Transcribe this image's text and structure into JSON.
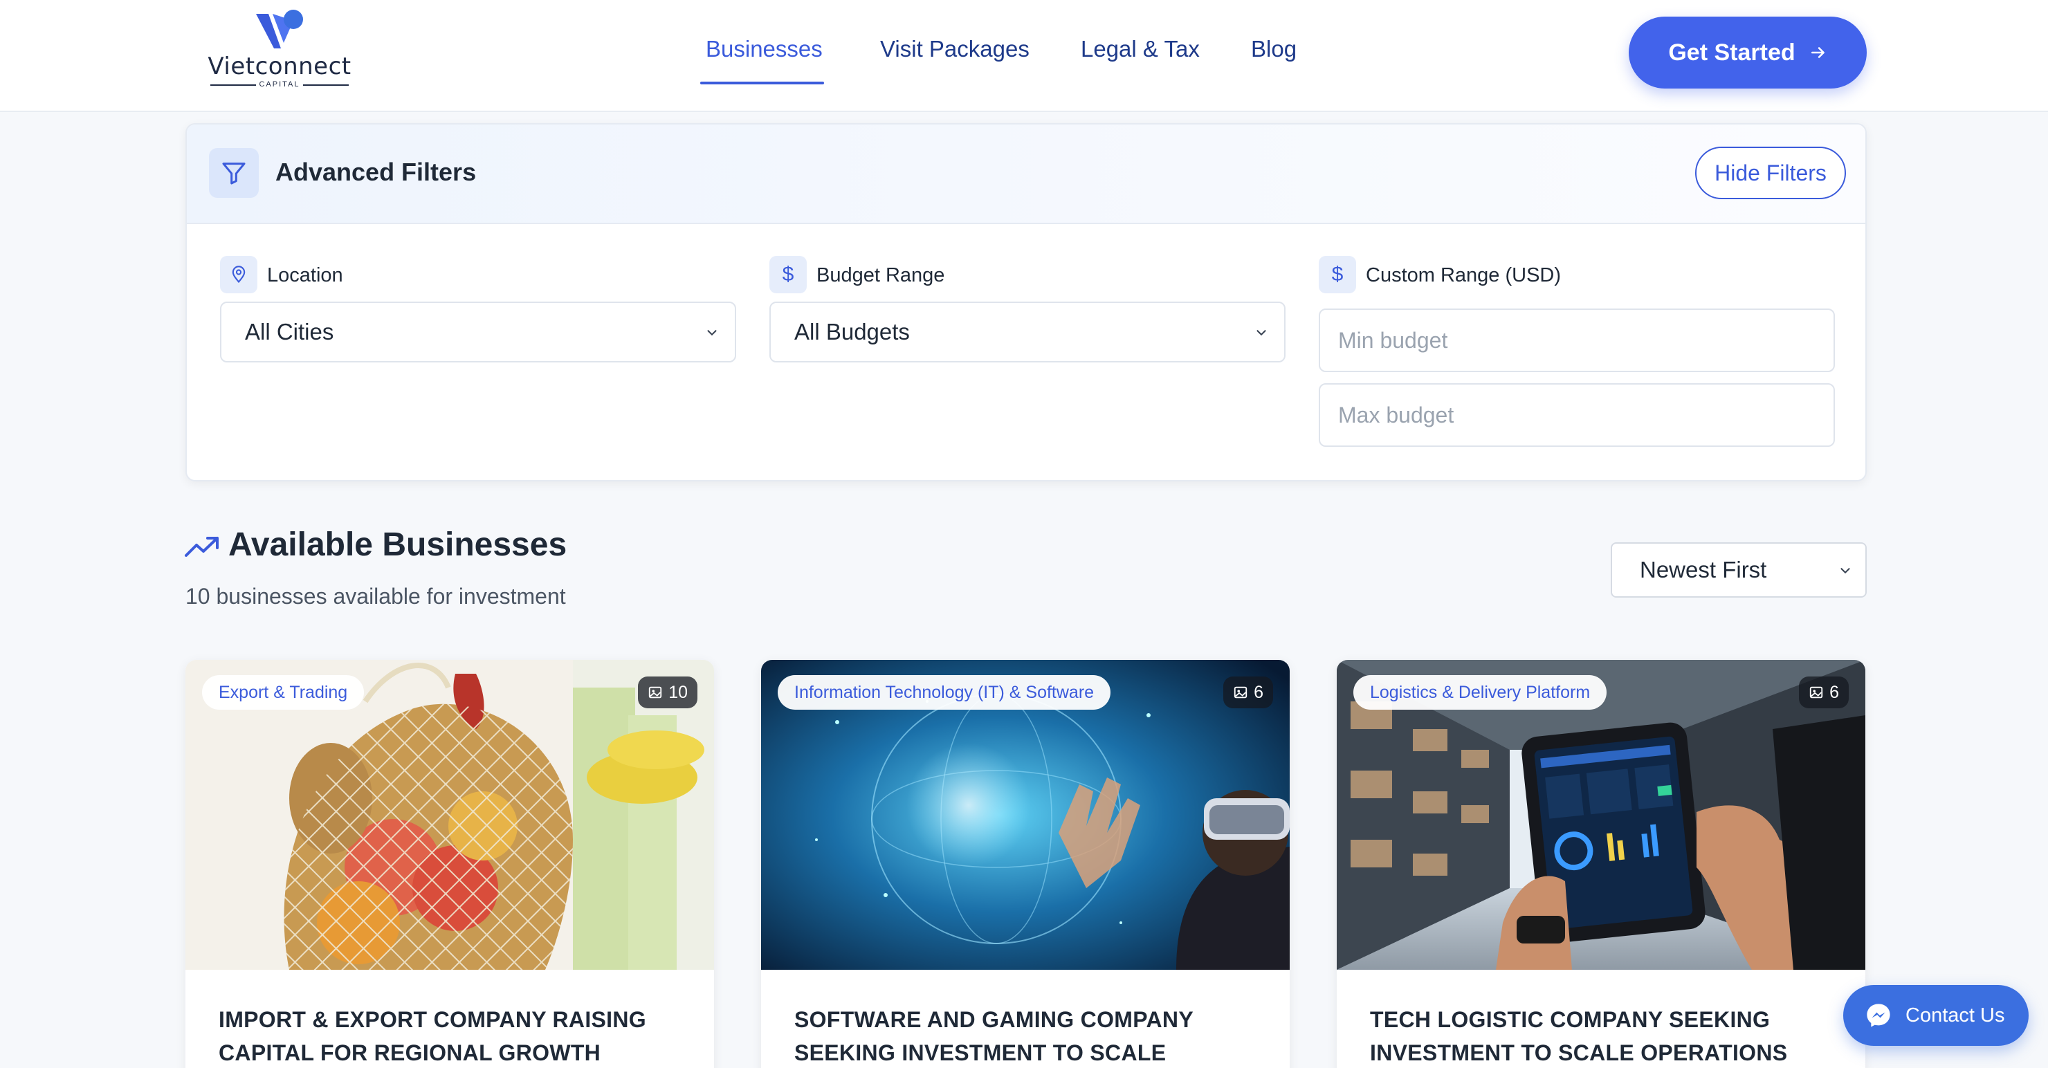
{
  "brand": {
    "name": "Vietconnect",
    "tagline": "CAPITAL",
    "color": "#3b5bdb"
  },
  "nav": {
    "items": [
      {
        "label": "Businesses",
        "active": true
      },
      {
        "label": "Visit Packages",
        "active": false
      },
      {
        "label": "Legal & Tax",
        "active": false
      },
      {
        "label": "Blog",
        "active": false
      }
    ],
    "cta_label": "Get Started"
  },
  "filters": {
    "title": "Advanced Filters",
    "hide_label": "Hide Filters",
    "location": {
      "label": "Location",
      "value": "All Cities",
      "icon": "map-pin-icon"
    },
    "budget": {
      "label": "Budget Range",
      "value": "All Budgets",
      "icon": "dollar-icon"
    },
    "custom": {
      "label": "Custom Range (USD)",
      "min_placeholder": "Min budget",
      "max_placeholder": "Max budget",
      "icon": "dollar-icon"
    }
  },
  "listing": {
    "title": "Available Businesses",
    "subtitle": "10 businesses available for investment",
    "sort_value": "Newest First"
  },
  "cards": [
    {
      "category": "Export & Trading",
      "image_count": "10",
      "title": "Import & Export Company Raising Capital for Regional Growth"
    },
    {
      "category": "Information Technology (IT) & Software",
      "image_count": "6",
      "title": "Software and Gaming Company Seeking Investment to Scale"
    },
    {
      "category": "Logistics & Delivery Platform",
      "image_count": "6",
      "title": "Tech Logistic Company Seeking Investment to Scale Operations"
    }
  ],
  "contact_label": "Contact Us"
}
